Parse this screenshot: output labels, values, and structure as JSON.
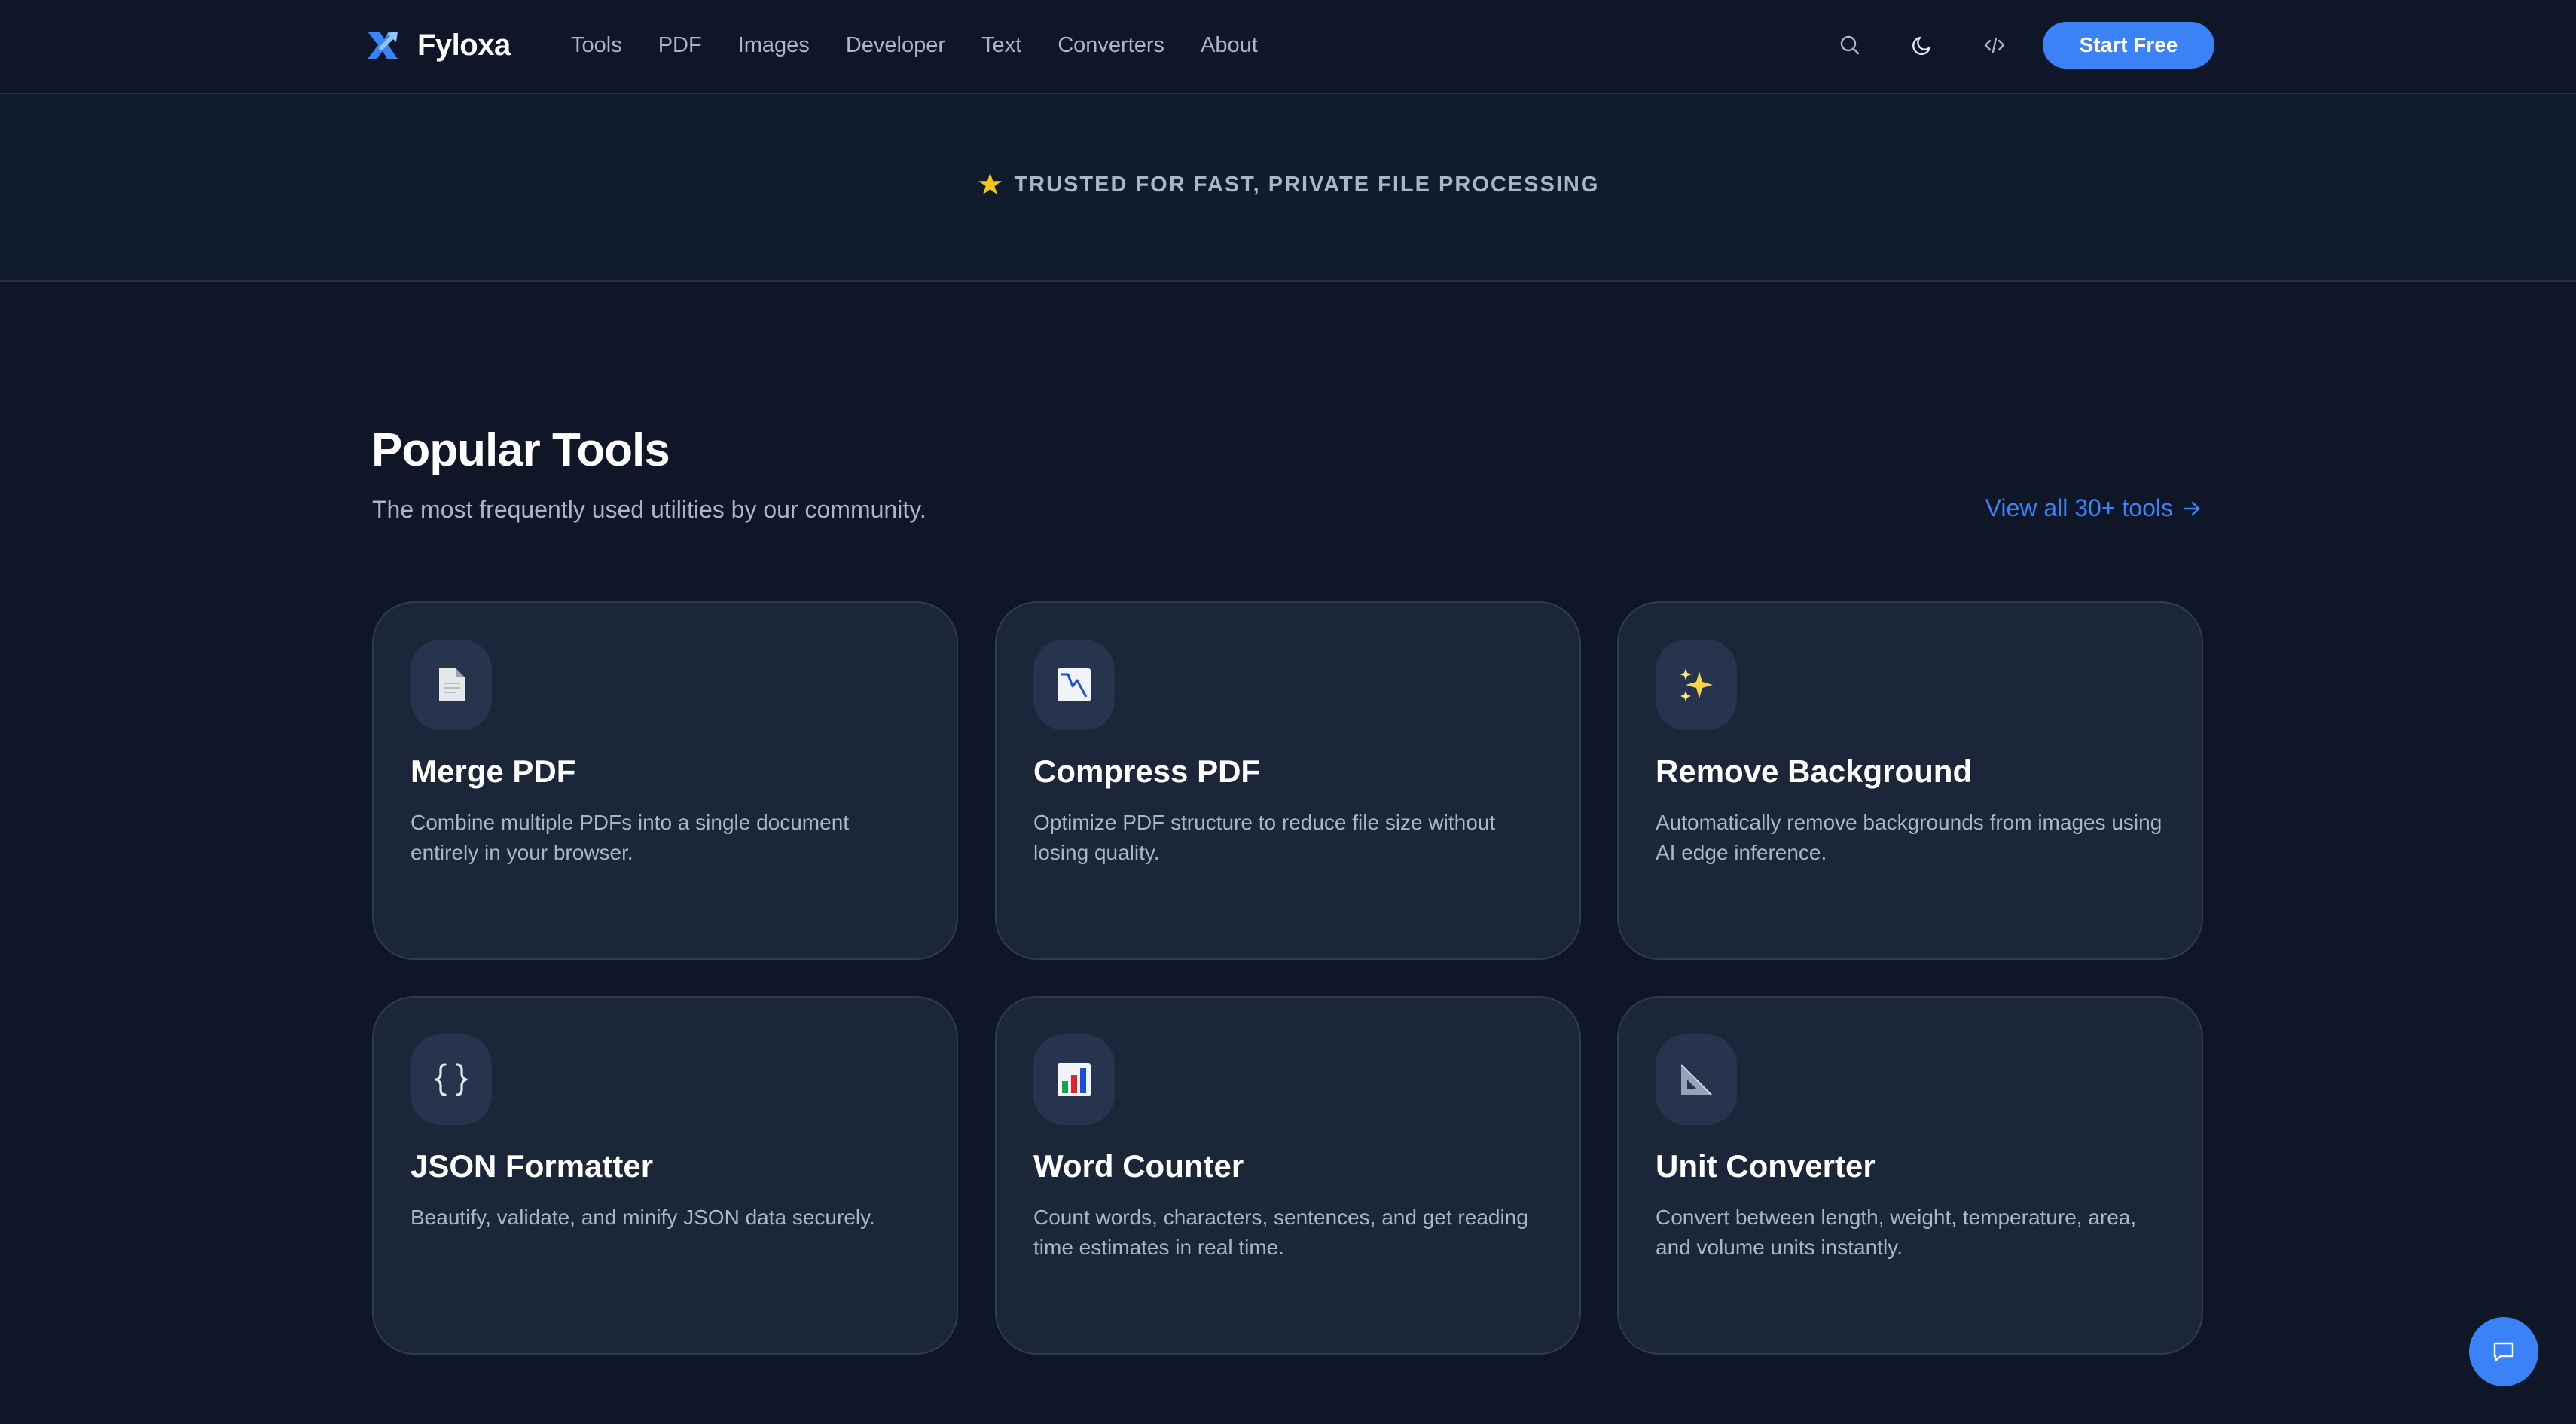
{
  "brand": {
    "name": "Fyloxa",
    "logo_icon": "fyloxa-logo-icon"
  },
  "nav": {
    "items": [
      {
        "label": "Tools"
      },
      {
        "label": "PDF"
      },
      {
        "label": "Images"
      },
      {
        "label": "Developer"
      },
      {
        "label": "Text"
      },
      {
        "label": "Converters"
      },
      {
        "label": "About"
      }
    ]
  },
  "header_actions": {
    "search_icon": "search-icon",
    "theme_icon": "moon-icon",
    "code_icon": "code-icon",
    "cta_label": "Start Free"
  },
  "trust": {
    "icon": "star-icon",
    "text": "TRUSTED FOR FAST, PRIVATE FILE PROCESSING"
  },
  "section": {
    "title": "Popular Tools",
    "subtitle": "The most frequently used utilities by our community.",
    "view_all": "View all 30+ tools"
  },
  "tools": [
    {
      "icon": "document-icon",
      "title": "Merge PDF",
      "description": "Combine multiple PDFs into a single document entirely in your browser."
    },
    {
      "icon": "chart-down-icon",
      "title": "Compress PDF",
      "description": "Optimize PDF structure to reduce file size without losing quality."
    },
    {
      "icon": "sparkles-icon",
      "title": "Remove Background",
      "description": "Automatically remove backgrounds from images using AI edge inference."
    },
    {
      "icon": "braces-icon",
      "title": "JSON Formatter",
      "description": "Beautify, validate, and minify JSON data securely."
    },
    {
      "icon": "bar-chart-icon",
      "title": "Word Counter",
      "description": "Count words, characters, sentences, and get reading time estimates in real time."
    },
    {
      "icon": "triangle-ruler-icon",
      "title": "Unit Converter",
      "description": "Convert between length, weight, temperature, area, and volume units instantly."
    }
  ],
  "chat": {
    "icon": "chat-icon"
  },
  "colors": {
    "background": "#0e1628",
    "card": "#1c2639",
    "accent": "#3b82f6",
    "star": "#f5c518",
    "muted_text": "#a9b5c8"
  }
}
